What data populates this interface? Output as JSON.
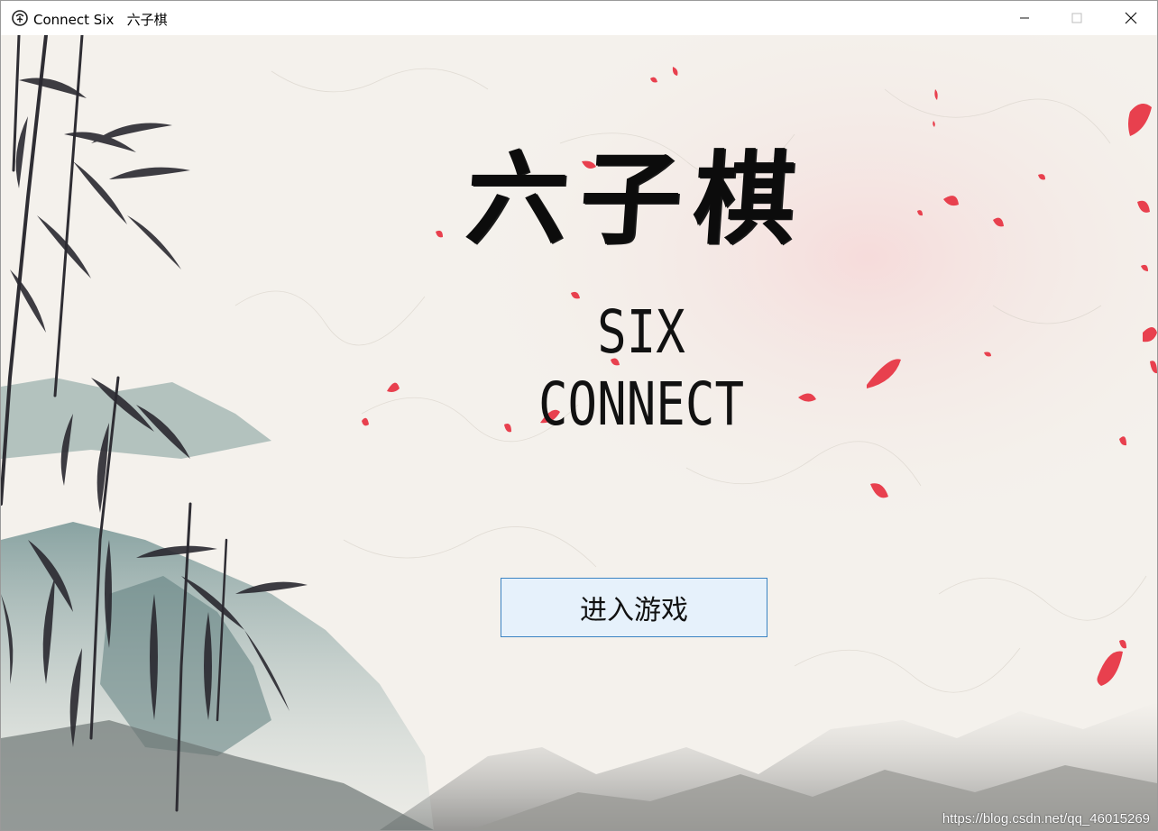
{
  "window": {
    "title": "Connect Six   六子棋",
    "app_icon": "game-logo-icon",
    "controls": {
      "minimize_icon": "minimize-icon",
      "maximize_icon": "maximize-icon",
      "close_icon": "close-icon"
    }
  },
  "main": {
    "title_cn": "六子棋",
    "title_en": "SIX CONNECT",
    "enter_button_label": "进入游戏",
    "watermark": "https://blog.csdn.net/qq_46015269"
  },
  "colors": {
    "paper_background": "#f3efe9",
    "button_fill": "#e6f1fb",
    "button_border": "#3b83c2",
    "petal_red": "#e8404e",
    "ink": "#0c0c0c"
  }
}
